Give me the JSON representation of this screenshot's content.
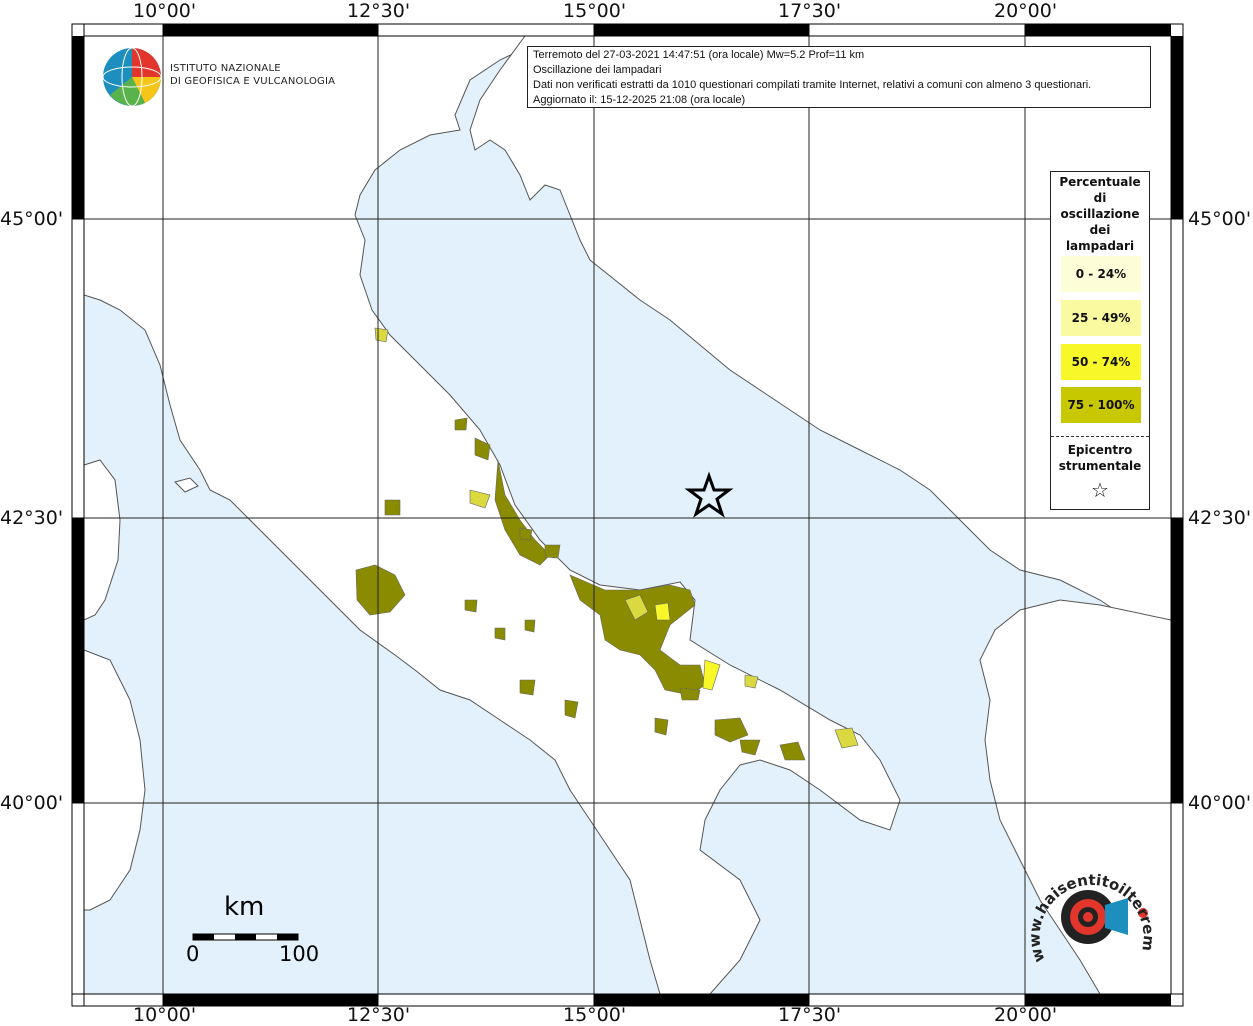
{
  "header": {
    "line1": "Terremoto del 27-03-2021 14:47:51 (ora locale) Mw=5.2 Prof=11 km",
    "line2": "Oscillazione dei lampadari",
    "line3": "Dati non verificati estratti da 1010 questionari compilati tramite Internet, relativi a comuni con almeno 3 questionari.",
    "line4": "Aggiornato il: 15-12-2025 21:08 (ora locale)"
  },
  "institute": {
    "line1": "ISTITUTO NAZIONALE",
    "line2": "DI GEOFISICA E VULCANOLOGIA"
  },
  "axes": {
    "lon_labels": [
      "10°00'",
      "12°30'",
      "15°00'",
      "17°30'",
      "20°00'"
    ],
    "lat_labels": [
      "45°00'",
      "42°30'",
      "40°00'"
    ]
  },
  "legend": {
    "title_lines": [
      "Percentuale",
      "di",
      "oscillazione",
      "dei",
      "lampadari"
    ],
    "items": [
      {
        "label": "0 - 24%",
        "color": "#fdfdd8"
      },
      {
        "label": "25 - 49%",
        "color": "#fafaa0"
      },
      {
        "label": "50 - 74%",
        "color": "#f8f828"
      },
      {
        "label": "75 - 100%",
        "color": "#c8c800"
      }
    ],
    "epicenter_line1": "Epicentro",
    "epicenter_line2": "strumentale",
    "epicenter_symbol": "☆"
  },
  "scale_bar": {
    "unit": "km",
    "min": "0",
    "max": "100"
  },
  "watermark": {
    "text": "www.haisentitoilterremoto.it"
  },
  "colors": {
    "sea": "#e2f1fb",
    "land": "#ffffff",
    "border": "#777777",
    "grid": "#222222",
    "olive": "#8b8b00",
    "light_yellow": "#dada40"
  }
}
